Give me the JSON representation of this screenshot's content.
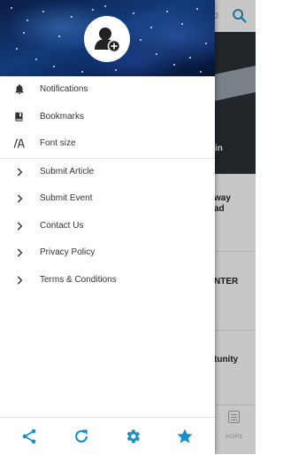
{
  "background": {
    "hero_snippet": "in",
    "card_snippets": [
      "way",
      "ad",
      "NTER",
      "tunity"
    ],
    "more_label": "MORE"
  },
  "drawer": {
    "items": [
      {
        "label": "Notifications",
        "icon": "bell-icon"
      },
      {
        "label": "Bookmarks",
        "icon": "book-icon"
      },
      {
        "label": "Font size",
        "icon": "font-size-icon"
      },
      {
        "label": "Submit Article",
        "icon": "chevron-right-icon"
      },
      {
        "label": "Submit Event",
        "icon": "chevron-right-icon"
      },
      {
        "label": "Contact Us",
        "icon": "chevron-right-icon"
      },
      {
        "label": "Privacy Policy",
        "icon": "chevron-right-icon"
      },
      {
        "label": "Terms & Conditions",
        "icon": "chevron-right-icon"
      }
    ],
    "bottom_icons": [
      "share-icon",
      "refresh-icon",
      "settings-icon",
      "star-icon"
    ]
  },
  "colors": {
    "accent": "#1a8ec8",
    "text": "#333333",
    "header_bg": "#0f2d66"
  }
}
